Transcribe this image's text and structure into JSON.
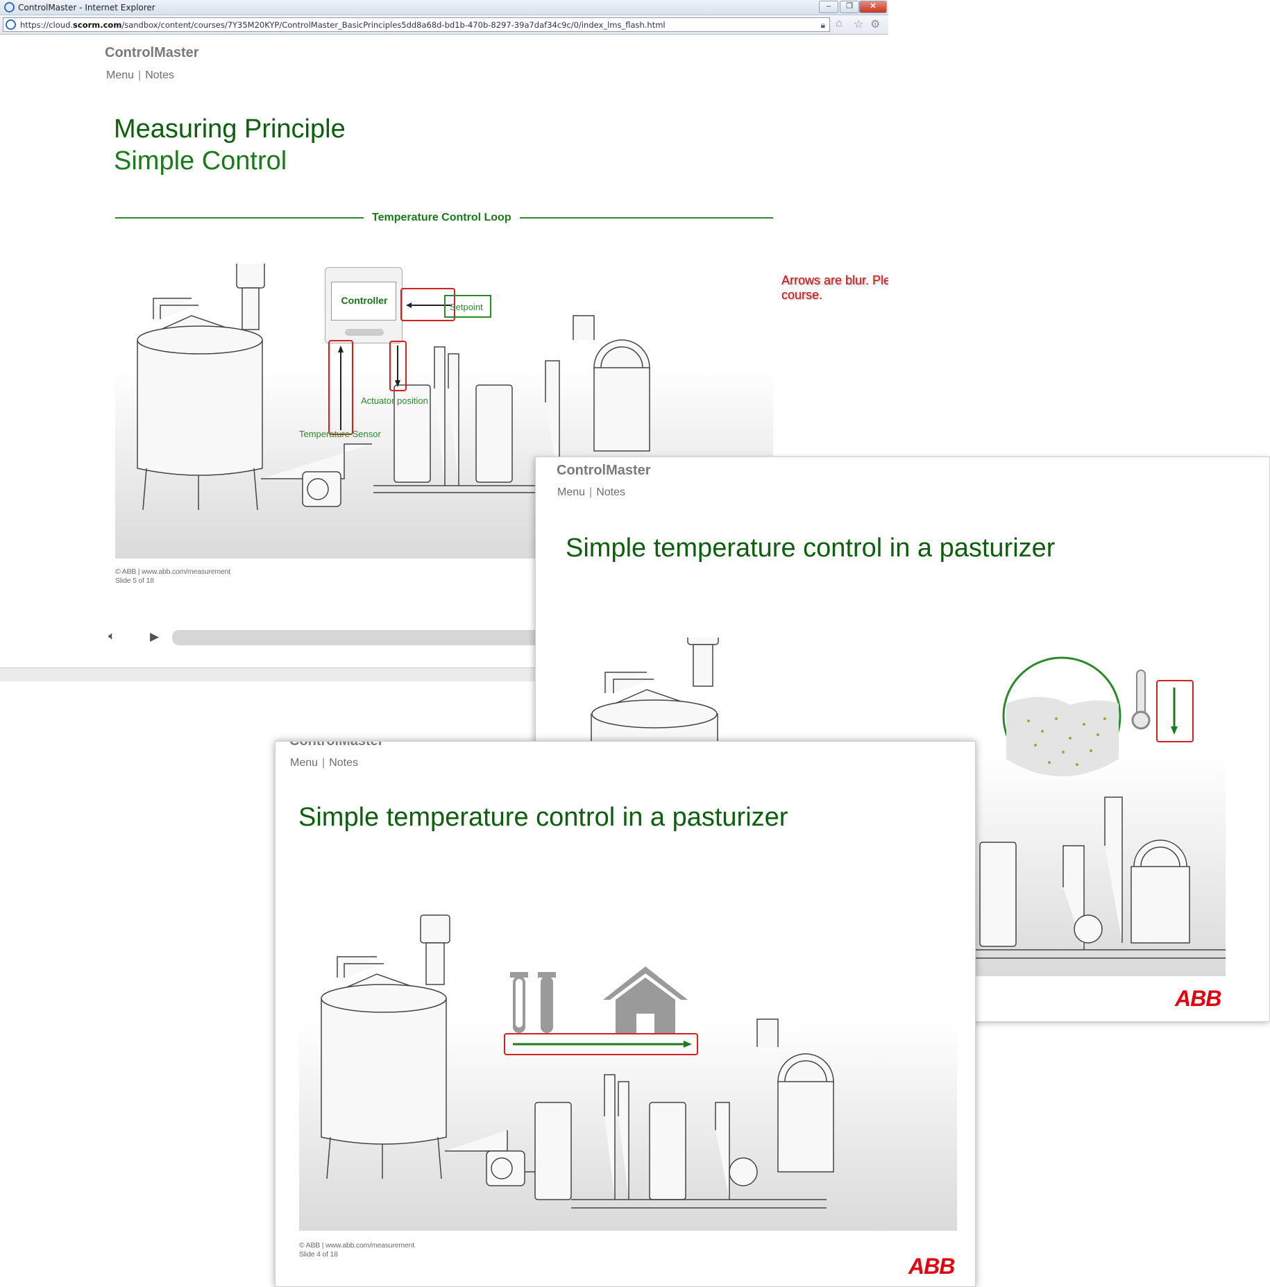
{
  "browser": {
    "window_title": "ControlMaster - Internet Explorer",
    "url_plain": "https://cloud.",
    "url_bold": "scorm.com",
    "url_rest": "/sandbox/content/courses/7Y35M20KYP/ControlMaster_BasicPrinciples5dd8a68d-bd1b-470b-8297-39a7daf34c9c/0/index_lms_flash.html"
  },
  "slides": [
    {
      "brand": "ControlMaster",
      "menu": "Menu",
      "notes": "Notes",
      "title_line1": "Measuring Principle",
      "title_line2": "Simple Control",
      "loop_title": "Temperature Control Loop",
      "controller_label": "Controller",
      "setpoint_label": "Setpoint",
      "actuator_label": "Actuator position",
      "sensor_label": "Temperature Sensor",
      "review_note": "Arrows are blur. Please refer base course.",
      "copyright": "© ABB | www.abb.com/measurement",
      "slide_counter": "Slide 5 of 18"
    },
    {
      "brand": "ControlMaster",
      "menu": "Menu",
      "notes": "Notes",
      "title": "Simple temperature control in a pasturizer",
      "logo": "ABB"
    },
    {
      "brand": "ControlMaster",
      "menu": "Menu",
      "notes": "Notes",
      "title": "Simple temperature control in a pasturizer",
      "copyright": "© ABB | www.abb.com/measurement",
      "slide_counter": "Slide 4 of 18",
      "logo": "ABB"
    }
  ],
  "colors": {
    "title_green": "#0d5e0d",
    "accent_green": "#2a8a2a",
    "highlight_red": "#d42020",
    "abb_red": "#e3000f"
  },
  "icons": [
    "ie-icon",
    "minimize-icon",
    "restore-icon",
    "close-icon",
    "lock-icon",
    "home-icon",
    "favorites-star-icon",
    "settings-gear-icon",
    "volume-icon",
    "play-icon",
    "test-tubes-icon",
    "house-icon",
    "thermometer-icon"
  ]
}
